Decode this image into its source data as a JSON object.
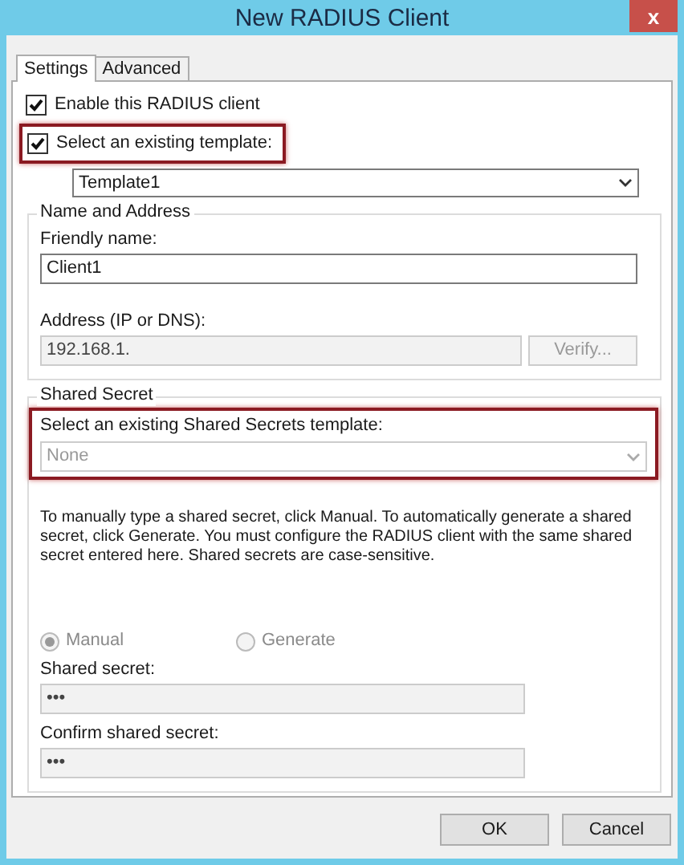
{
  "window": {
    "title": "New RADIUS Client",
    "close": "x"
  },
  "tabs": [
    {
      "label": "Settings",
      "selected": true
    },
    {
      "label": "Advanced",
      "selected": false
    }
  ],
  "enable_client": {
    "label": "Enable this RADIUS client",
    "checked": true
  },
  "use_template": {
    "label": "Select an existing template:",
    "checked": true,
    "highlighted": true
  },
  "template_dropdown": {
    "value": "Template1",
    "disabled": false
  },
  "name_and_address": {
    "title": "Name and Address",
    "friendly_name": {
      "label": "Friendly name:",
      "value": "Client1"
    },
    "address": {
      "label": "Address (IP or DNS):",
      "value": "192.168.1.",
      "disabled": true
    },
    "verify_button": {
      "label": "Verify...",
      "disabled": true
    }
  },
  "shared_secret": {
    "title": "Shared Secret",
    "template": {
      "label": "Select an existing Shared Secrets template:",
      "value": "None",
      "disabled": true,
      "highlighted": true
    },
    "description": "To manually type a shared secret, click Manual. To automatically generate a shared secret, click Generate. You must configure the RADIUS client with the same shared secret entered here. Shared secrets are case-sensitive.",
    "modes": [
      {
        "label": "Manual",
        "selected": true,
        "disabled": true
      },
      {
        "label": "Generate",
        "selected": false,
        "disabled": true
      }
    ],
    "secret": {
      "label": "Shared secret:",
      "value": "•••",
      "disabled": true
    },
    "confirm": {
      "label": "Confirm shared secret:",
      "value": "•••",
      "disabled": true
    }
  },
  "buttons": [
    {
      "label": "OK"
    },
    {
      "label": "Cancel"
    }
  ]
}
